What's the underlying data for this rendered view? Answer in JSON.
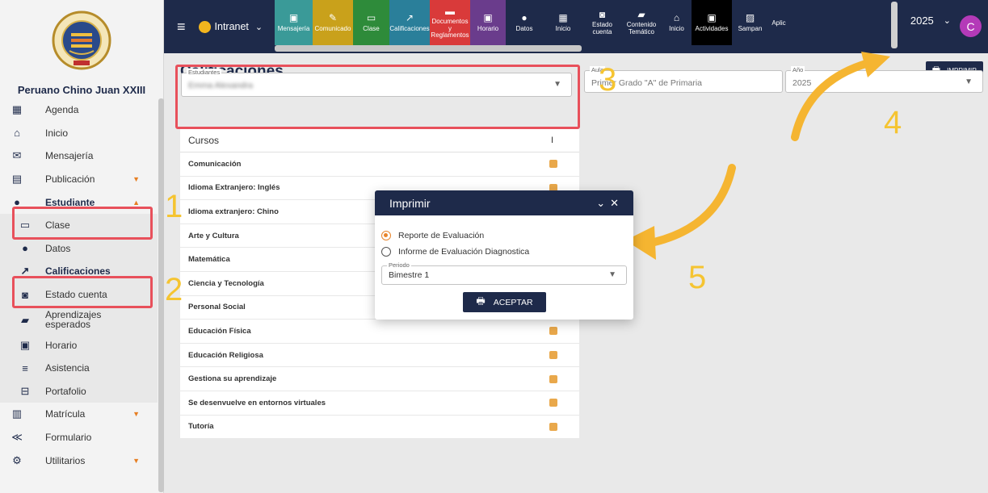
{
  "sidebar": {
    "school_name": "Peruano Chino Juan XXIII",
    "items": [
      {
        "label": "Agenda",
        "icon": "calendar-icon"
      },
      {
        "label": "Inicio",
        "icon": "home-icon"
      },
      {
        "label": "Mensajería",
        "icon": "message-icon"
      },
      {
        "label": "Publicación",
        "icon": "publication-icon"
      },
      {
        "label": "Estudiante",
        "icon": "student-icon"
      },
      {
        "label": "Clase",
        "icon": "monitor-icon"
      },
      {
        "label": "Datos",
        "icon": "person-icon"
      },
      {
        "label": "Calificaciones",
        "icon": "chart-icon"
      },
      {
        "label": "Estado cuenta",
        "icon": "money-icon"
      },
      {
        "label": "Aprendizajes esperados",
        "icon": "book-icon"
      },
      {
        "label": "Horario",
        "icon": "schedule-icon"
      },
      {
        "label": "Asistencia",
        "icon": "list-icon"
      },
      {
        "label": "Portafolio",
        "icon": "briefcase-icon"
      },
      {
        "label": "Matrícula",
        "icon": "enroll-icon"
      },
      {
        "label": "Formulario",
        "icon": "form-icon"
      },
      {
        "label": "Utilitarios",
        "icon": "tools-icon"
      }
    ]
  },
  "topbar": {
    "app_selector": "Intranet",
    "modules": [
      {
        "label": "Mensajería",
        "color": "#3a9a98"
      },
      {
        "label": "Comunicado",
        "color": "#c9a11b"
      },
      {
        "label": "Clase",
        "color": "#2e8b3a"
      },
      {
        "label": "Calificaciones",
        "color": "#2a7f9a"
      },
      {
        "label": "Documentos y Reglamentos",
        "color": "#d93a3a"
      },
      {
        "label": "Horario",
        "color": "#6a3c8c"
      },
      {
        "label": "Datos",
        "color": "#1e2a4a"
      },
      {
        "label": "Inicio",
        "color": "#1e2a4a"
      },
      {
        "label": "Estado cuenta",
        "color": "#1e2a4a"
      },
      {
        "label": "Contenido Temático",
        "color": "#1e2a4a"
      },
      {
        "label": "Inicio",
        "color": "#1e2a4a"
      },
      {
        "label": "Actividades",
        "color": "#000000"
      },
      {
        "label": "Sampan",
        "color": "#1e2a4a"
      },
      {
        "label": "Aplic",
        "color": "#1e2a4a"
      }
    ],
    "year": "2025",
    "avatar_letter": "C"
  },
  "main": {
    "title": "Calificaciones",
    "print_label": "IMPRIMIR",
    "students_label": "Estudiantes",
    "students_value": "Emma Alexandra",
    "aula_label": "Aula",
    "aula_value": "Primer Grado \"A\" de Primaria",
    "year_label": "Año",
    "year_value": "2025",
    "courses_header": "Cursos",
    "courses_col": "I",
    "courses": [
      "Comunicación",
      "Idioma Extranjero: Inglés",
      "Idioma extranjero: Chino",
      "Arte y Cultura",
      "Matemática",
      "Ciencia y Tecnología",
      "Personal Social",
      "Educación Física",
      "Educación Religiosa",
      "Gestiona su aprendizaje",
      "Se desenvuelve en entornos virtuales",
      "Tutoría"
    ]
  },
  "modal": {
    "title": "Imprimir",
    "options": [
      "Reporte de Evaluación",
      "Informe de Evaluación Diagnostica"
    ],
    "selected_option": "Reporte de Evaluación",
    "period_label": "Periodo",
    "period_value": "Bimestre 1",
    "accept_label": "ACEPTAR"
  },
  "annotations": {
    "steps": [
      "1",
      "2",
      "3",
      "4",
      "5"
    ],
    "highlight_color": "#e8505b",
    "number_color": "#f5c431"
  }
}
